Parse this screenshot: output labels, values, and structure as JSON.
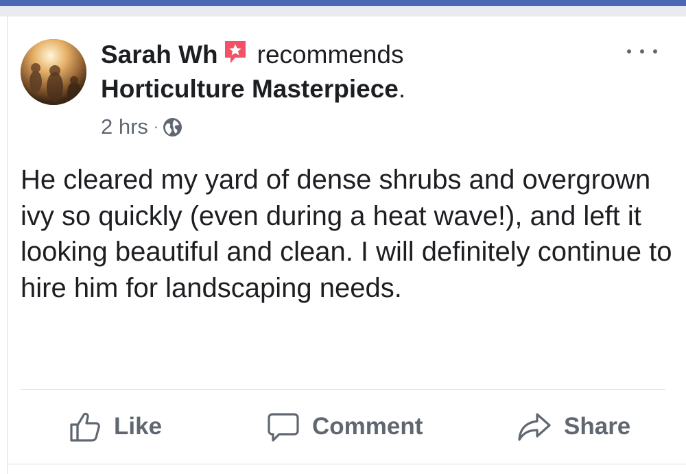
{
  "post": {
    "author": "Sarah Wh",
    "action_text": "recommends",
    "target": "Horticulture Masterpiece",
    "target_suffix": ".",
    "timestamp": "2 hrs",
    "separator": "·",
    "privacy_icon": "globe-icon",
    "recommend_icon": "recommend-star-icon",
    "body": "He cleared my yard of dense shrubs and overgrown ivy so quickly (even during a heat wave!), and left it looking beautiful and clean.  I will definitely continue to hire him for landscaping needs."
  },
  "actions": {
    "like_label": "Like",
    "comment_label": "Comment",
    "share_label": "Share"
  },
  "colors": {
    "top_bar": "#4c68b4",
    "recommend_badge": "#f25268",
    "secondary_text": "#606770"
  }
}
